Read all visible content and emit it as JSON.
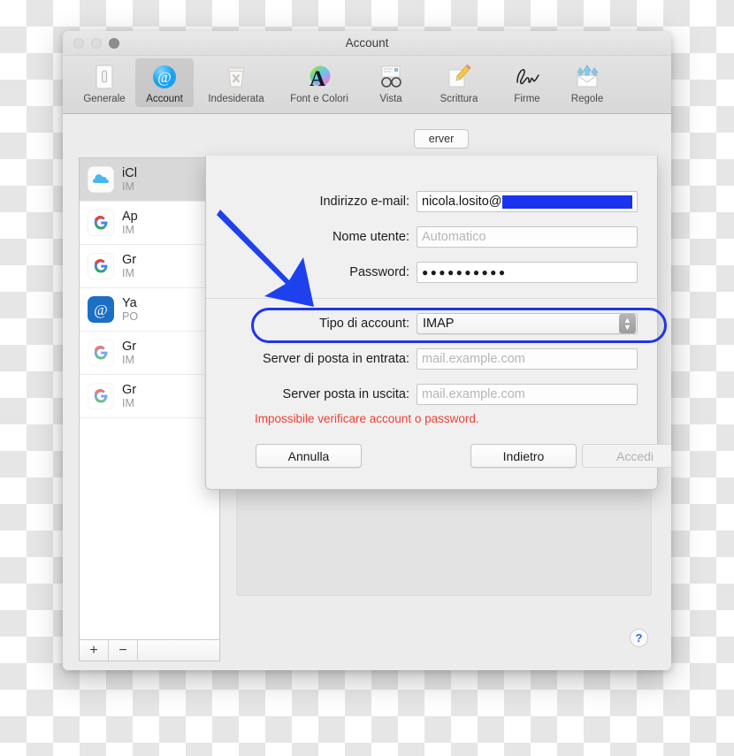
{
  "window": {
    "title": "Account",
    "traffic_lights": [
      "close-light",
      "minimize-light",
      "zoom-light"
    ]
  },
  "toolbar": {
    "items": [
      {
        "label": "Generale",
        "icon": "general-icon",
        "selected": false
      },
      {
        "label": "Account",
        "icon": "at-sign-icon",
        "selected": true
      },
      {
        "label": "Indesiderata",
        "icon": "junk-bin-icon",
        "selected": false
      },
      {
        "label": "Font e Colori",
        "icon": "font-color-icon",
        "selected": false
      },
      {
        "label": "Vista",
        "icon": "glasses-icon",
        "selected": false
      },
      {
        "label": "Scrittura",
        "icon": "pencil-icon",
        "selected": false
      },
      {
        "label": "Firme",
        "icon": "signature-icon",
        "selected": false
      },
      {
        "label": "Regole",
        "icon": "rules-icon",
        "selected": false
      }
    ]
  },
  "sidebar": {
    "accounts": [
      {
        "name": "iCl",
        "protocol": "IM",
        "icon": "icloud-icon",
        "selected": true
      },
      {
        "name": "Ap",
        "protocol": "IM",
        "icon": "google-icon",
        "selected": false
      },
      {
        "name": "Gr",
        "protocol": "IM",
        "icon": "google-icon",
        "selected": false
      },
      {
        "name": "Ya",
        "protocol": "PO",
        "icon": "at-box-icon",
        "selected": false
      },
      {
        "name": "Gr",
        "protocol": "IM",
        "icon": "google-icon",
        "selected": false
      },
      {
        "name": "Gr",
        "protocol": "IM",
        "icon": "google-icon",
        "selected": false
      }
    ],
    "add_label": "+",
    "remove_label": "−"
  },
  "detail": {
    "tab_label": "erver",
    "help_label": "?"
  },
  "sheet": {
    "fields": [
      {
        "label": "Indirizzo e-mail:",
        "value": "nicola.losito@",
        "placeholder": "",
        "redacted": true,
        "type": "text"
      },
      {
        "label": "Nome utente:",
        "value": "",
        "placeholder": "Automatico",
        "redacted": false,
        "type": "text"
      },
      {
        "label": "Password:",
        "value": "●●●●●●●●●●",
        "placeholder": "",
        "redacted": false,
        "type": "password"
      },
      {
        "label": "Server di posta in entrata:",
        "value": "",
        "placeholder": "mail.example.com",
        "redacted": false,
        "type": "text"
      },
      {
        "label": "Server posta in uscita:",
        "value": "",
        "placeholder": "mail.example.com",
        "redacted": false,
        "type": "text"
      }
    ],
    "account_type": {
      "label": "Tipo di account:",
      "value": "IMAP"
    },
    "error": "Impossibile verificare account o password.",
    "buttons": {
      "cancel": "Annulla",
      "back": "Indietro",
      "signin": "Accedi"
    }
  },
  "annotation": {
    "arrow": "blue-arrow-annotation",
    "highlight": "blue-oval-highlight"
  },
  "colors": {
    "accent_blue": "#2134e8",
    "redaction_blue": "#1a33ef",
    "error_red": "#f04035",
    "window_bg": "#ececec",
    "sheet_bg": "#f0f0f0"
  }
}
